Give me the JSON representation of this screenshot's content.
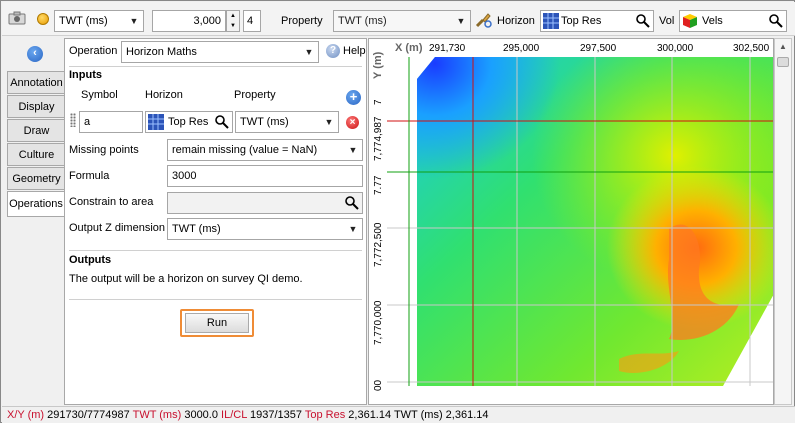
{
  "toolbar": {
    "attribute_select": "TWT (ms)",
    "number_value": "3,000",
    "step_value": "4",
    "property_label": "Property",
    "property_select": "TWT (ms)",
    "horizon_label": "Horizon",
    "horizon_value": "Top Res",
    "vol_label": "Vol",
    "vol_value": "Vels"
  },
  "tabs": [
    "Annotation",
    "Display",
    "Draw",
    "Culture",
    "Geometry",
    "Operations"
  ],
  "active_tab": "Operations",
  "panel": {
    "operation_label": "Operation",
    "operation_value": "Horizon Maths",
    "help_label": "Help",
    "inputs_header": "Inputs",
    "col_symbol": "Symbol",
    "col_horizon": "Horizon",
    "col_property": "Property",
    "row_symbol": "a",
    "row_horizon": "Top Res",
    "row_property": "TWT (ms)",
    "missing_label": "Missing points",
    "missing_value": "remain missing (value = NaN)",
    "formula_label": "Formula",
    "formula_value": "3000",
    "constrain_label": "Constrain to area",
    "constrain_value": "",
    "output_z_label": "Output Z dimension",
    "output_z_value": "TWT (ms)",
    "outputs_header": "Outputs",
    "outputs_text": "The output will be a horizon on survey QI demo.",
    "run_label": "Run"
  },
  "map": {
    "x_axis_label": "X (m)",
    "y_axis_label": "Y (m)",
    "x_ticks": [
      "291,730",
      "295,000",
      "297,500",
      "300,000",
      "302,500"
    ],
    "y_ticks": [
      "7,774,987",
      "7,772,500",
      "7,770,000"
    ],
    "y_partial_ticks": [
      "7",
      "7.77",
      "00"
    ],
    "crosshair_color": "#d01010",
    "marker_color": "#10a010"
  },
  "status": {
    "xy_key": "X/Y (m)",
    "xy_val": "291730/7774987",
    "twt_key": "TWT (ms)",
    "twt_val": "3000.0",
    "ilcl_key": "IL/CL",
    "ilcl_val": "1937/1357",
    "topres_key": "Top Res",
    "topres_val": "2,361.14 TWT (ms) 2,361.14"
  },
  "colors": {
    "run_highlight": "#ef8c36",
    "status_key": "#c8102e"
  }
}
